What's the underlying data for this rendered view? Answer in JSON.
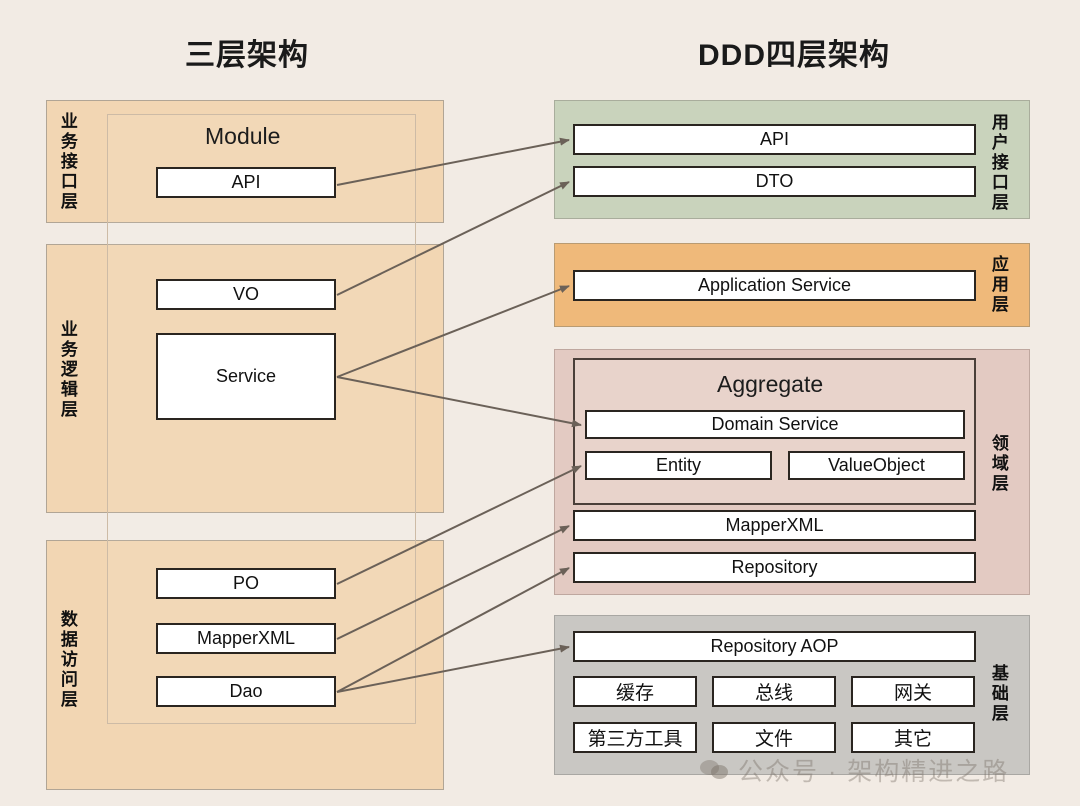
{
  "titles": {
    "left": "三层架构",
    "right": "DDD四层架构"
  },
  "left_column": {
    "module_label": "Module",
    "layers": [
      {
        "side_label": "业务接口层",
        "items": [
          "API"
        ]
      },
      {
        "side_label": "业务逻辑层",
        "items": [
          "VO",
          "Service"
        ]
      },
      {
        "side_label": "数据访问层",
        "items": [
          "PO",
          "MapperXML",
          "Dao"
        ]
      }
    ]
  },
  "right_column": {
    "aggregate_label": "Aggregate",
    "layers": [
      {
        "side_label": "用户接口层",
        "color": "#c9d3bc",
        "items": [
          "API",
          "DTO"
        ]
      },
      {
        "side_label": "应用层",
        "color": "#efb97a",
        "items": [
          "Application Service"
        ]
      },
      {
        "side_label": "领域层",
        "color": "#e3cac2",
        "items": [
          "Domain Service",
          "Entity",
          "ValueObject",
          "MapperXML",
          "Repository"
        ]
      },
      {
        "side_label": "基础层",
        "color": "#c9c7c3",
        "items": [
          "Repository AOP",
          "缓存",
          "总线",
          "网关",
          "第三方工具",
          "文件",
          "其它"
        ]
      }
    ]
  },
  "watermark": "公众号 · 架构精进之路",
  "colors": {
    "background": "#f2ebe4",
    "left_panel": "#f2d6b3",
    "user_interface_layer": "#c9d3bc",
    "application_layer": "#efb97a",
    "domain_layer": "#e3cac2",
    "aggregate": "#e8d3cb",
    "infrastructure_layer": "#c9c7c3",
    "arrow": "#6b6158",
    "box_border": "#2a2520"
  }
}
